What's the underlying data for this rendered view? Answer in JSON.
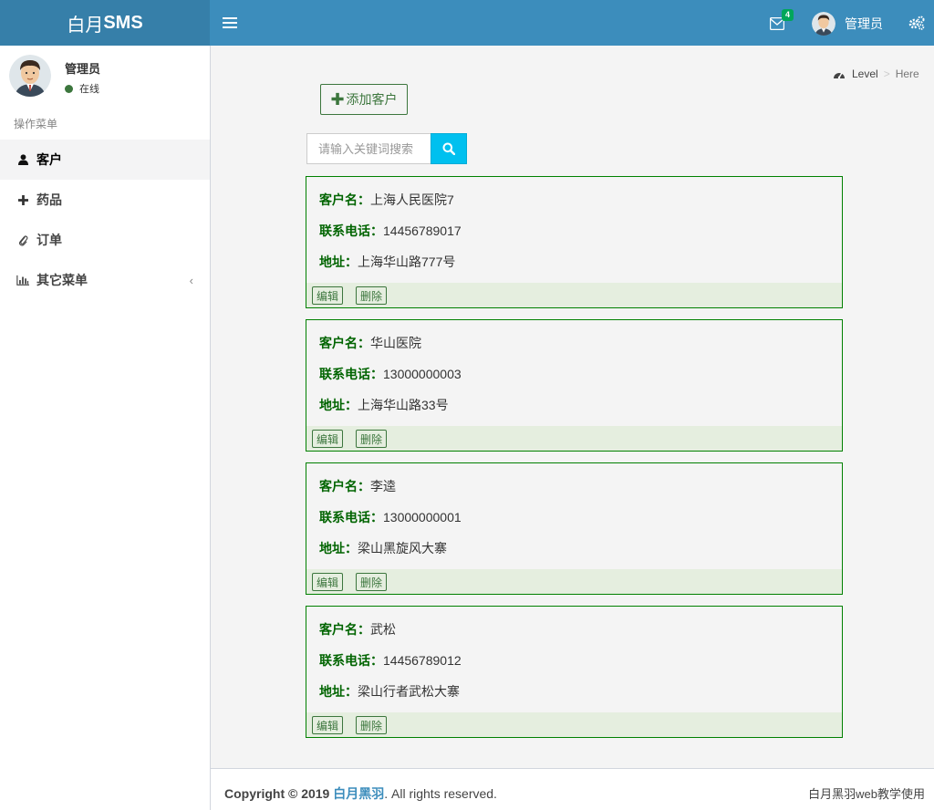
{
  "app": {
    "logo_light": "白月",
    "logo_bold": "SMS"
  },
  "header": {
    "mail_count": "4",
    "user_name": "管理员"
  },
  "sidebar": {
    "user_name": "管理员",
    "user_status": "在线",
    "menu_header": "操作菜单",
    "items": [
      {
        "label": "客户",
        "icon": "user-icon"
      },
      {
        "label": "药品",
        "icon": "plus-icon"
      },
      {
        "label": "订单",
        "icon": "paperclip-icon"
      },
      {
        "label": "其它菜单",
        "icon": "bar-chart-icon"
      }
    ]
  },
  "breadcrumb": {
    "level": "Level",
    "sep": ">",
    "here": "Here"
  },
  "toolbar": {
    "add_label": "添加客户",
    "search_placeholder": "请输入关键词搜索"
  },
  "labels": {
    "name": "客户名：",
    "phone": "联系电话：",
    "address": "地址：",
    "edit": "编辑",
    "delete": "删除"
  },
  "customers": [
    {
      "name": "上海人民医院7",
      "phone": "14456789017",
      "address": "上海华山路777号"
    },
    {
      "name": "华山医院",
      "phone": "13000000003",
      "address": "上海华山路33号"
    },
    {
      "name": "李逵",
      "phone": "13000000001",
      "address": "梁山黑旋风大寨"
    },
    {
      "name": "武松",
      "phone": "14456789012",
      "address": "梁山行者武松大寨"
    }
  ],
  "footer": {
    "copyright_prefix": "Copyright © 2019 ",
    "brand": "白月黑羽",
    "suffix": ". All rights reserved.",
    "right_text": "白月黑羽web教学使用"
  },
  "colors": {
    "header": "#3c8dbc",
    "logo_bg": "#367fa9",
    "accent_green": "#008000",
    "search_btn": "#00c0ef"
  }
}
